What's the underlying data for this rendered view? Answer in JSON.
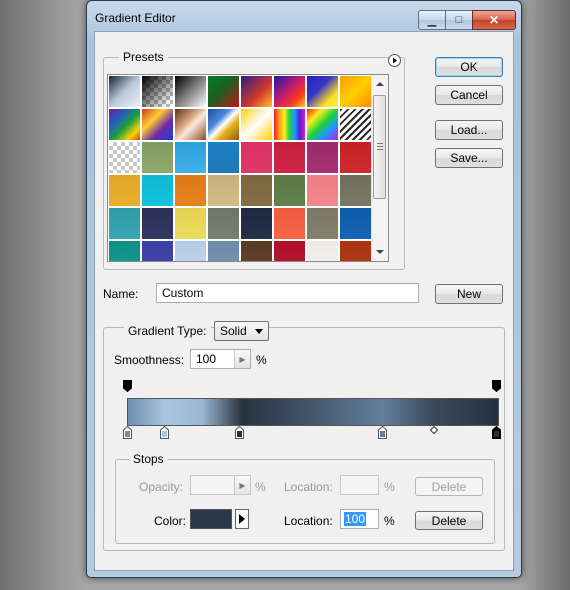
{
  "window": {
    "title": "Gradient Editor",
    "controls": {
      "minimize": "▁",
      "maximize": "□",
      "close": "✕"
    }
  },
  "presets": {
    "label": "Presets",
    "menu_icon": "flyout-menu-icon",
    "swatches": [
      "linear-gradient(135deg,#1b2330 0%,#b7c7d7 50%,#eef3f8 100%)",
      "linear-gradient(135deg,#000 0%,rgba(0,0,0,0) 90%),repeating-conic-gradient(#bbb 0 25%,#fff 0 50%) 0 0/8px 8px",
      "linear-gradient(135deg,#000 0%,#fff 100%)",
      "linear-gradient(135deg,#0b7a2a 0%,#1b5f1f 45%,#c5171b 100%)",
      "linear-gradient(135deg,#2b1c86 0%,#d33a2a 60%,#ffc02b 100%)",
      "linear-gradient(135deg,#1a1aa8 0%,#c01a72 45%,#ff3b1a 75%,#ffd21b 100%)",
      "linear-gradient(135deg,#2323b8 0%,#3a36c6 40%,#ffe01b 75%,#f8f05a 100%)",
      "linear-gradient(135deg,#ff9b00 0%,#ffcf00 50%,#ff8a00 100%)",
      "linear-gradient(135deg,#7b1a8c 0%,#1f5fbf 30%,#1e9f3b 55%,#ffd200 80%,#e53b15 100%)",
      "linear-gradient(135deg,#d33b1a 0%,#ffcc33 35%,#6d2aa6 65%,#1d3fd1 100%)",
      "linear-gradient(135deg,#5a3214 0%,#d9a581 40%,#fbe9dd 55%,#8a4b22 100%)",
      "linear-gradient(135deg,#1b4f9e 0%,#4d86d8 35%,#ffffff 50%,#e9b21c 65%,#8a5a12 100%)",
      "linear-gradient(135deg,#ffd100 0%,#ffffff 50%,#ffd100 100%),linear-gradient(#fff,#fff)",
      "linear-gradient(90deg,#ff1b1b,#ff9b1b,#ffee1b,#1bd33b,#1b9bff,#5b1bd3,#e31bd3)",
      "linear-gradient(135deg,#ff1b1b 0%,#ffee1b 25%,#1bd33b 50%,#1b9bff 70%,#c81bd3 100%)",
      "repeating-linear-gradient(135deg,#2a2a2a 0px,#2a2a2a 2px,#ffffff 2px,#ffffff 5px)",
      "repeating-conic-gradient(#c8c8c8 0 25%,#fff 0 50%) 0 0/8px 8px",
      "linear-gradient(#7f9a62,#91a86a)",
      "linear-gradient(#2d9fdc,#3fb0ea)",
      "linear-gradient(#1b7fc4,#1f78ba)",
      "linear-gradient(#d83264,#e03a6c)",
      "linear-gradient(#c41e3f,#d02747)",
      "linear-gradient(#9b2a6a,#a63373)",
      "linear-gradient(#c52024,#d12a2e)",
      "linear-gradient(#e1a526,#e8b12a)",
      "linear-gradient(#0fb7d1,#14c3dc)",
      "linear-gradient(#dd7a17,#e6841c)",
      "linear-gradient(#c7b07e,#d4bc89)",
      "linear-gradient(#7a6640,#846f47)",
      "linear-gradient(#5b7845,#64834c)",
      "linear-gradient(#ec7f86,#f3888f)",
      "linear-gradient(#6e6e5c,#7a7a66)",
      "linear-gradient(#2f9aa7,#38a7b4)",
      "linear-gradient(#2a2f55,#323864)",
      "linear-gradient(#e4d254,#ecdc5e)",
      "linear-gradient(#6e7467,#787e70)",
      "linear-gradient(#1f2840,#263049)",
      "linear-gradient(#f05a3e,#f86548)",
      "linear-gradient(#7a7764,#84816d)",
      "linear-gradient(#0f5ba8,#1565b5)",
      "linear-gradient(#0f8e86,#149a92)",
      "linear-gradient(#3a3fa0,#4448ac)",
      "linear-gradient(#b3cbe6,#c3d6ec)",
      "linear-gradient(#6b8aa6,#7897b2)",
      "linear-gradient(#5a3a24,#654230)",
      "linear-gradient(#b0102a,#bc1733)",
      "linear-gradient(#eceae4,#f4f2ec)",
      "linear-gradient(#a73412,#b63d18)",
      "linear-gradient(#f6f6f6,#ffffff)"
    ]
  },
  "buttons": {
    "ok": "OK",
    "cancel": "Cancel",
    "load": "Load...",
    "save": "Save...",
    "new": "New",
    "delete_opacity": "Delete",
    "delete_color": "Delete"
  },
  "name_field": {
    "label": "Name:",
    "value": "Custom"
  },
  "gradient": {
    "type_label": "Gradient Type:",
    "type_value": "Solid",
    "smoothness_label": "Smoothness:",
    "smoothness_value": "100",
    "smoothness_unit": "%"
  },
  "stops": {
    "label": "Stops",
    "opacity_label": "Opacity:",
    "opacity_value": "",
    "opacity_unit": "%",
    "opacity_location_label": "Location:",
    "opacity_location_value": "",
    "opacity_location_unit": "%",
    "color_label": "Color:",
    "color_value": "#2b3a4b",
    "color_location_label": "Location:",
    "color_location_value": "100",
    "color_location_unit": "%",
    "opacity_stops": [
      0,
      100
    ],
    "color_stops": [
      {
        "pos": 0,
        "color": "#6d8fb0"
      },
      {
        "pos": 10,
        "color": "#a8c6e2"
      },
      {
        "pos": 31,
        "color": "#27323f"
      },
      {
        "pos": 69,
        "color": "#637f9c"
      },
      {
        "pos": 100,
        "color": "#243040",
        "selected": true
      }
    ],
    "midpoint": 84
  }
}
